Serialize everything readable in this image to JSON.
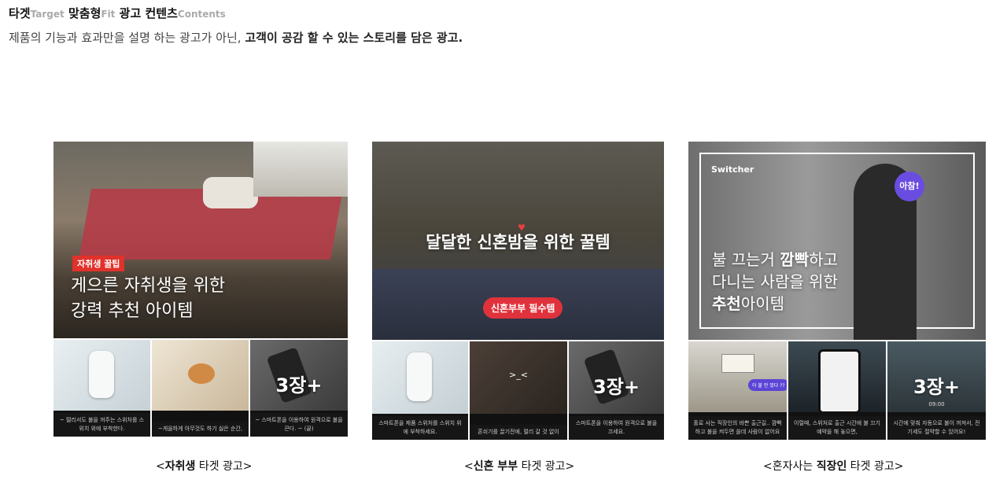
{
  "header": {
    "title_ko_1": "타겟",
    "title_en_1": "Target",
    "title_ko_2": "맞춤형",
    "title_en_2": "Fit",
    "title_ko_3": "광고 컨텐츠",
    "title_en_3": "Contents",
    "subtitle_normal": "제품의 기능과 효과만을 설명 하는 광고가 아닌, ",
    "subtitle_bold": "고객이 공감 할 수 있는 스토리를 담은 광고."
  },
  "cards": [
    {
      "tag": "자취생 꿀팁",
      "line1": "게으른 자취생을 위한",
      "line2": "강력 추천 아이템",
      "thumb1_caption": "~ 떨리서도 불을 꺼주는 스위처를 스위치 위에 부착한다.",
      "thumb2_caption": "~게을하게 아무것도 하기 싫은 순간,",
      "thumb3_caption": "~ 스마트폰을 이용하여 원격으로 불을 끈다. ~ (끝)",
      "thumb3_more": "3장+",
      "label_open": "<",
      "label_bold": "자취생",
      "label_rest": " 타겟 광고>"
    },
    {
      "title": "달달한 신혼밤을 위한 꿀템",
      "badge": "신혼부부 필수템",
      "thumb1_caption": "스마트폰을 제품 스위처를 스위치 위에 부착하세요.",
      "thumb2_caption": "혼쉬기를 끌기전에, 멀리 갈 것 없이",
      "thumb2_emote": ">_<",
      "thumb3_caption": "스마트폰을 이용하여 원격으로 불을 끄세요.",
      "thumb3_more": "3장+",
      "label_open": "<",
      "label_bold": "신혼 부부",
      "label_rest": " 타겟 광고>"
    },
    {
      "brand": "Switcher",
      "bubble": "아참!",
      "line1_a": "불 끄는거 ",
      "line1_b": "깜빡",
      "line1_c": "하고",
      "line2": "다니는 사람을 위한",
      "line3_a": "추천",
      "line3_b": "아이템",
      "thumb1_caption": "홀로 사는 직장인의 바쁜 출근길.. 깜빡하고 불을 켜두면 쓸데 사람이 없어요",
      "thumb1_bubble": "아 불 안 껐다 ??",
      "thumb2_caption": "이럴때, 스위처로 출근 시간에 불 끄기 예약을 해 놓으면,",
      "thumb3_caption": "시간에 맞춰 자동으로 불이 꺼져서, 전기세도 절약할 수 있어요!",
      "thumb3_time": "09:00",
      "thumb3_more": "3장+",
      "label_open": "<혼자사는 ",
      "label_bold": "직장인",
      "label_rest": " 타겟 광고>"
    }
  ]
}
